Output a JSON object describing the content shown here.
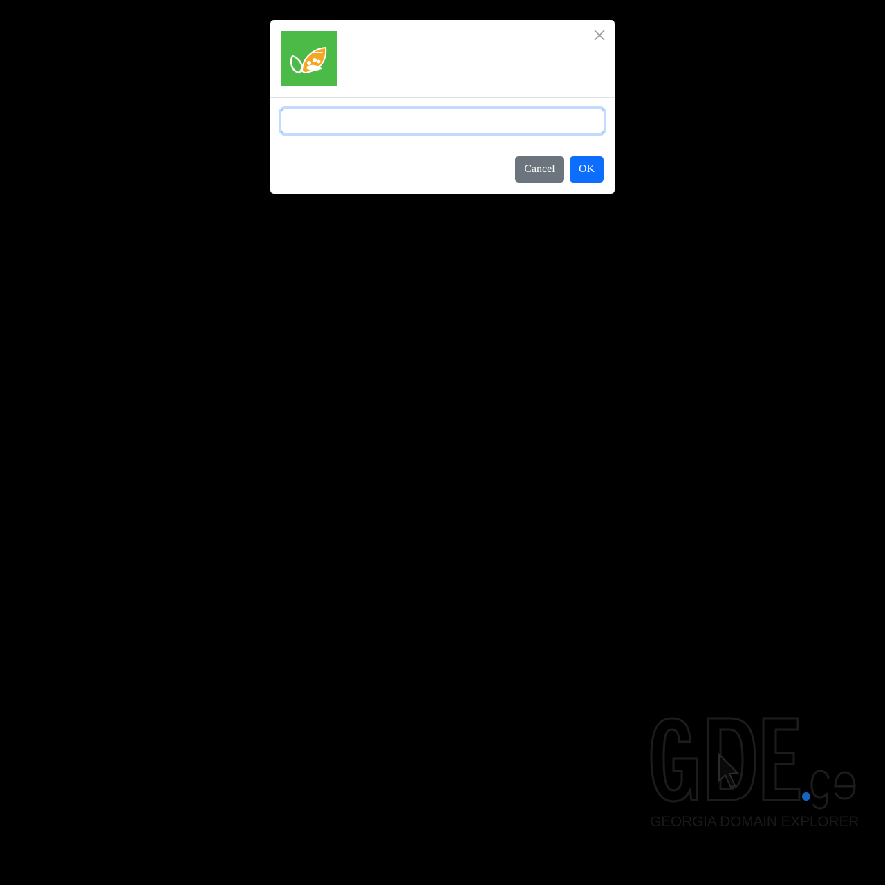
{
  "dialog": {
    "input": {
      "value": "",
      "placeholder": ""
    },
    "buttons": {
      "cancel_label": "Cancel",
      "ok_label": "OK"
    },
    "icons": {
      "logo": "leaf-hands-logo",
      "close": "close-icon"
    }
  },
  "watermark": {
    "logo_text": "GDE.ge",
    "caption": "GEORGIA DOMAIN EXPLORER"
  },
  "colors": {
    "background": "#000000",
    "modal": "#ffffff",
    "logo_green": "#4cba47",
    "logo_orange": "#f5a623",
    "cancel": "#6c757d",
    "ok": "#0d6efd",
    "watermark_dot": "#1565c0"
  }
}
